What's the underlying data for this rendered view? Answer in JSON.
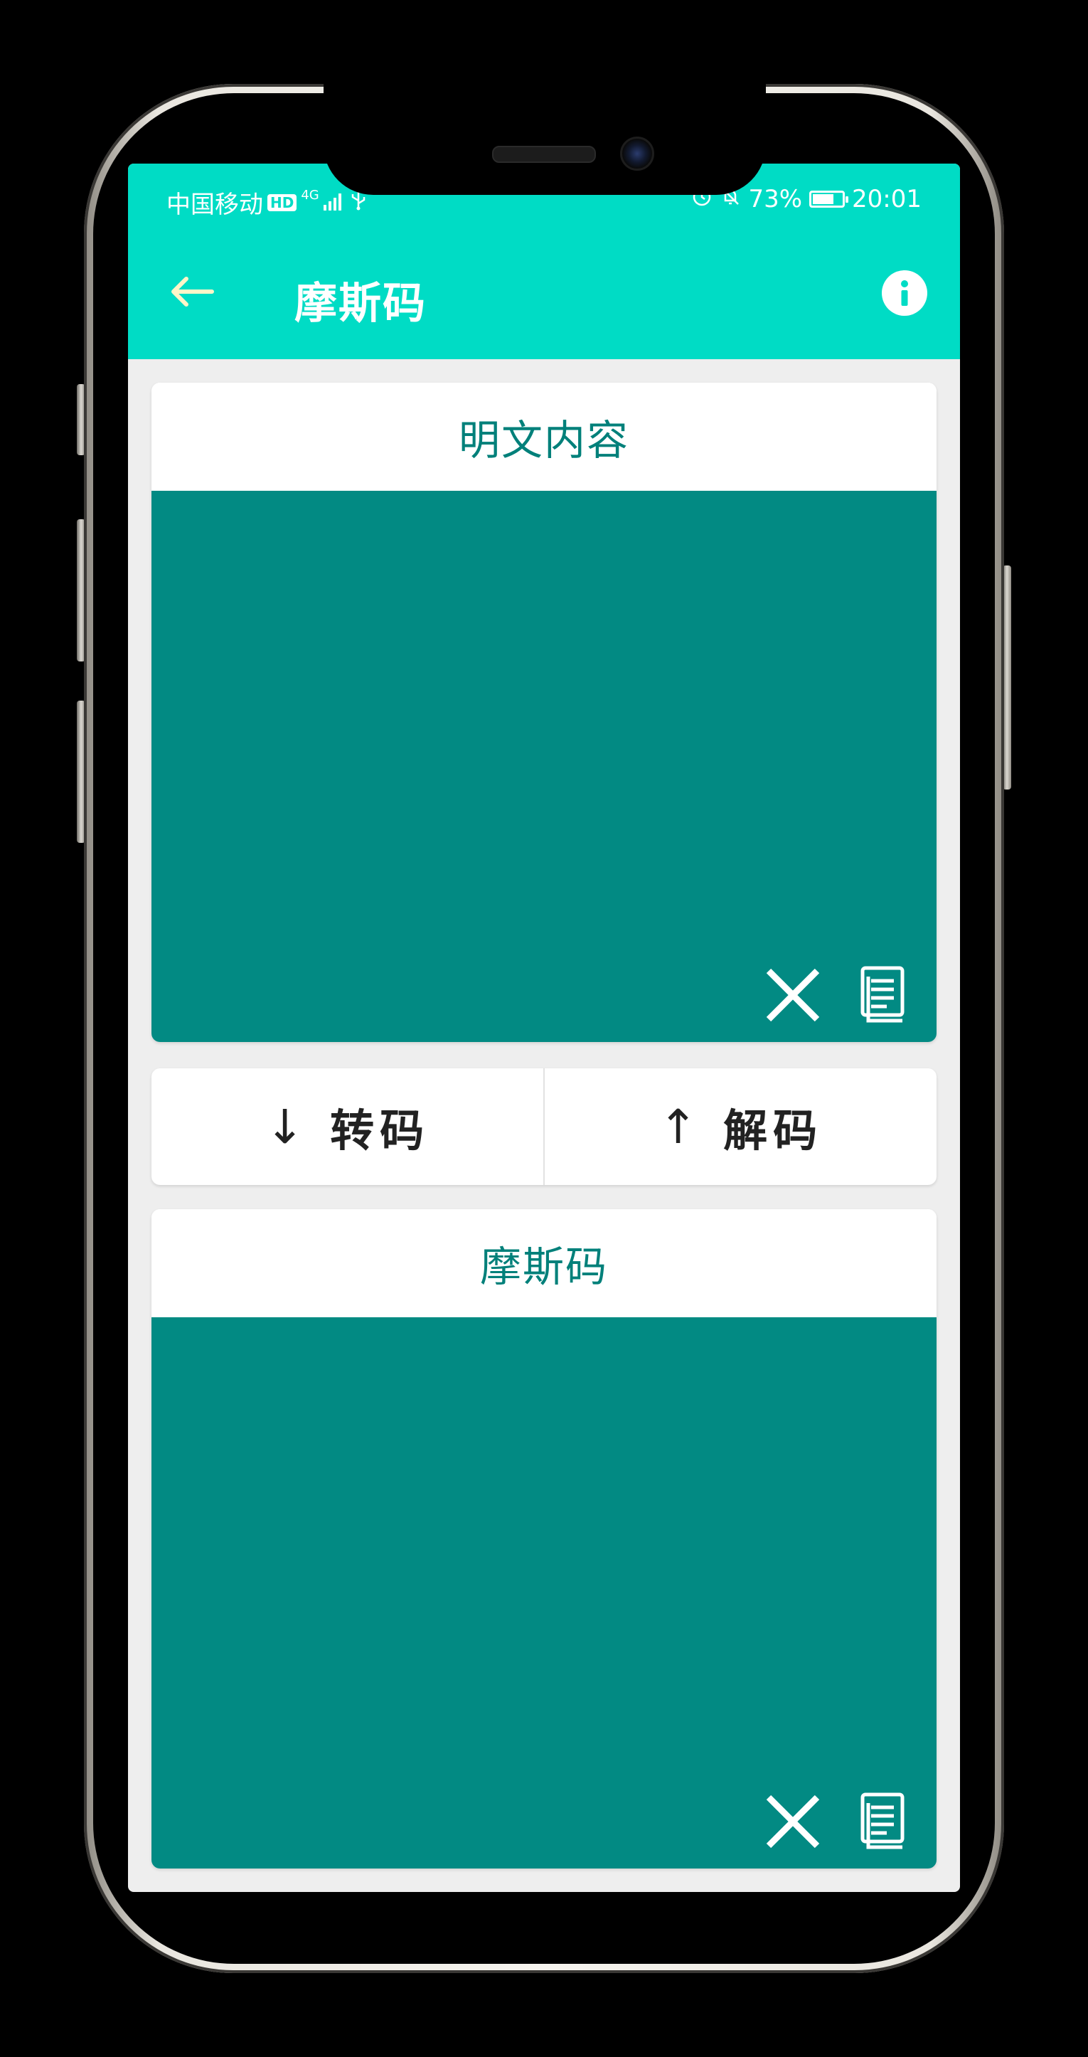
{
  "status_bar": {
    "carrier": "中国移动",
    "hd": "HD",
    "net_type": "4G",
    "battery_percent": "73%",
    "battery_level": 0.73,
    "time": "20:01"
  },
  "app_bar": {
    "title": "摩斯码",
    "back_icon": "arrow-left-icon",
    "info_icon": "info-icon",
    "color": "#00dcc5"
  },
  "plain_card": {
    "header": "明文内容",
    "value": "",
    "clear_icon": "close-icon",
    "copy_icon": "copy-icon"
  },
  "actions": {
    "encode": {
      "arrow": "↓",
      "label": "转码"
    },
    "decode": {
      "arrow": "↑",
      "label": "解码"
    }
  },
  "morse_card": {
    "header": "摩斯码",
    "value": "",
    "clear_icon": "close-icon",
    "copy_icon": "copy-icon"
  },
  "colors": {
    "accent": "#00dcc5",
    "panel": "#028a83",
    "header_text": "#00807a",
    "background": "#eeeeee"
  }
}
